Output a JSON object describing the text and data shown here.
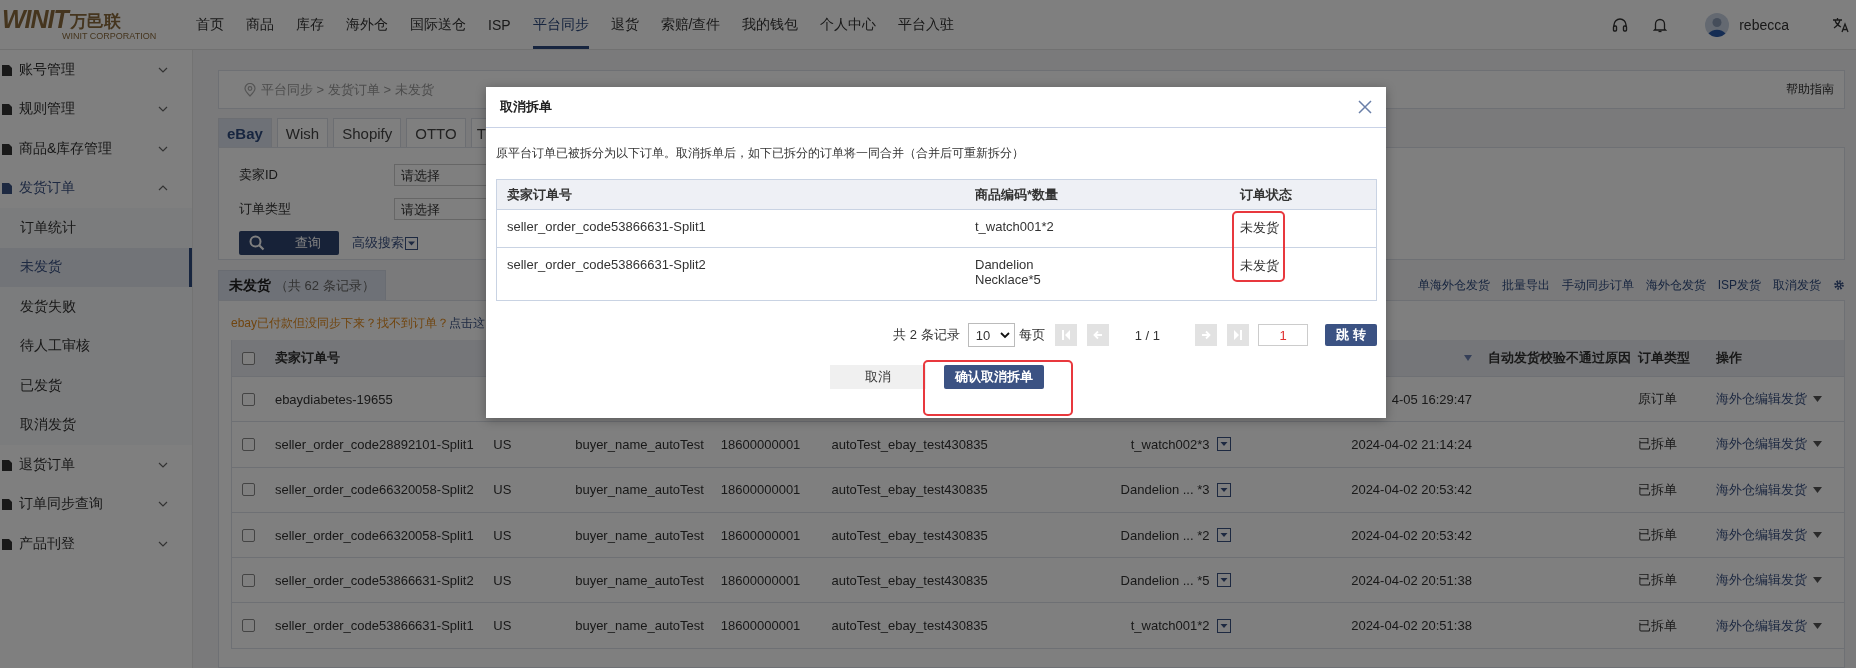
{
  "topbar": {
    "logo_mark": "WINIT",
    "logo_cn": "万邑联",
    "logo_en": "WINIT CORPORATION",
    "nav": [
      {
        "label": "首页",
        "selected": false
      },
      {
        "label": "商品",
        "selected": false
      },
      {
        "label": "库存",
        "selected": false
      },
      {
        "label": "海外仓",
        "selected": false
      },
      {
        "label": "国际送仓",
        "selected": false
      },
      {
        "label": "ISP",
        "selected": false
      },
      {
        "label": "平台同步",
        "selected": true
      },
      {
        "label": "退货",
        "selected": false
      },
      {
        "label": "索赔/查件",
        "selected": false
      },
      {
        "label": "我的钱包",
        "selected": false
      },
      {
        "label": "个人中心",
        "selected": false
      },
      {
        "label": "平台入驻",
        "selected": false
      }
    ],
    "user_name": "rebecca"
  },
  "sidebar": {
    "items": [
      {
        "label": "账号管理",
        "expanded": false
      },
      {
        "label": "规则管理",
        "expanded": false
      },
      {
        "label": "商品&库存管理",
        "expanded": false
      },
      {
        "label": "发货订单",
        "expanded": true,
        "children": [
          {
            "label": "订单统计",
            "selected": false
          },
          {
            "label": "未发货",
            "selected": true
          },
          {
            "label": "发货失败",
            "selected": false
          },
          {
            "label": "待人工审核",
            "selected": false
          },
          {
            "label": "已发货",
            "selected": false
          },
          {
            "label": "取消发货",
            "selected": false
          }
        ]
      },
      {
        "label": "退货订单",
        "expanded": false
      },
      {
        "label": "订单同步查询",
        "expanded": false
      },
      {
        "label": "产品刊登",
        "expanded": false
      }
    ]
  },
  "breadcrumb": "平台同步 > 发货订单 > 未发货",
  "help_link": "帮助指南",
  "platform_tabs": [
    {
      "label": "eBay",
      "selected": true
    },
    {
      "label": "Wish",
      "selected": false
    },
    {
      "label": "Shopify",
      "selected": false
    },
    {
      "label": "OTTO",
      "selected": false
    },
    {
      "label": "T",
      "selected": false
    }
  ],
  "filters": [
    {
      "label": "卖家ID",
      "placeholder": "请选择"
    },
    {
      "label": "订单类型",
      "placeholder": "请选择"
    }
  ],
  "search_button": "查询",
  "advanced_search": "高级搜索",
  "section_tab": {
    "title": "未发货",
    "count": "（共 62 条记录）",
    "selected": true
  },
  "toolbar_actions": [
    "单海外仓发货",
    "批量导出",
    "手动同步订单",
    "海外仓发货",
    "ISP发货",
    "取消发货"
  ],
  "notice": {
    "text": "ebay已付款但没同步下来？找不到订单？",
    "link": "点击这"
  },
  "table": {
    "all_checked": false,
    "header": {
      "order_no": "卖家订单号",
      "reason": "自动发货校验不通过原因",
      "order_type": "订单类型",
      "action": "操作"
    },
    "rows": [
      {
        "checked": false,
        "order_no": "ebaydiabetes-19655",
        "time": "4-05 16:29:47",
        "order_type": "原订单",
        "action": "海外仓编辑发货"
      },
      {
        "checked": false,
        "order_no": "seller_order_code28892101-Split1",
        "country": "US",
        "buyer": "buyer_name_autoTest",
        "phone": "18600000001",
        "account": "autoTest_ebay_test430835",
        "product": "t_watch002*3",
        "time": "2024-04-02 21:14:24",
        "order_type": "已拆单",
        "action": "海外仓编辑发货"
      },
      {
        "checked": false,
        "order_no": "seller_order_code66320058-Split2",
        "country": "US",
        "buyer": "buyer_name_autoTest",
        "phone": "18600000001",
        "account": "autoTest_ebay_test430835",
        "product": "Dandelion ... *3",
        "time": "2024-04-02 20:53:42",
        "order_type": "已拆单",
        "action": "海外仓编辑发货"
      },
      {
        "checked": false,
        "order_no": "seller_order_code66320058-Split1",
        "country": "US",
        "buyer": "buyer_name_autoTest",
        "phone": "18600000001",
        "account": "autoTest_ebay_test430835",
        "product": "Dandelion ... *2",
        "time": "2024-04-02 20:53:42",
        "order_type": "已拆单",
        "action": "海外仓编辑发货"
      },
      {
        "checked": false,
        "order_no": "seller_order_code53866631-Split2",
        "country": "US",
        "buyer": "buyer_name_autoTest",
        "phone": "18600000001",
        "account": "autoTest_ebay_test430835",
        "product": "Dandelion ... *5",
        "time": "2024-04-02 20:51:38",
        "order_type": "已拆单",
        "action": "海外仓编辑发货"
      },
      {
        "checked": false,
        "order_no": "seller_order_code53866631-Split1",
        "country": "US",
        "buyer": "buyer_name_autoTest",
        "phone": "18600000001",
        "account": "autoTest_ebay_test430835",
        "product": "t_watch001*2",
        "time": "2024-04-02 20:51:38",
        "order_type": "已拆单",
        "action": "海外仓编辑发货"
      }
    ]
  },
  "dialog": {
    "title": "取消拆单",
    "description": "原平台订单已被拆分为以下订单。取消拆单后，如下已拆分的订单将一同合并（合并后可重新拆分）",
    "columns": [
      "卖家订单号",
      "商品编码*数量",
      "订单状态"
    ],
    "rows": [
      {
        "order_no": "seller_order_code53866631-Split1",
        "product": "t_watch001*2",
        "status": "未发货"
      },
      {
        "order_no": "seller_order_code53866631-Split2",
        "product": "Dandelion\nNecklace*5",
        "status": "未发货"
      }
    ],
    "pager": {
      "total": "共 2 条记录",
      "page_size": "10",
      "per_page": "每页",
      "back_buttons": [
        {
          "kind": "first",
          "disabled": true
        },
        {
          "kind": "prev",
          "disabled": true
        }
      ],
      "page": "1 / 1",
      "forward_buttons": [
        {
          "kind": "next",
          "disabled": true
        },
        {
          "kind": "last",
          "disabled": true
        }
      ],
      "jump_value": "1",
      "jump_button": "跳 转"
    },
    "cancel_button": "取消",
    "confirm_button": "确认取消拆单"
  }
}
